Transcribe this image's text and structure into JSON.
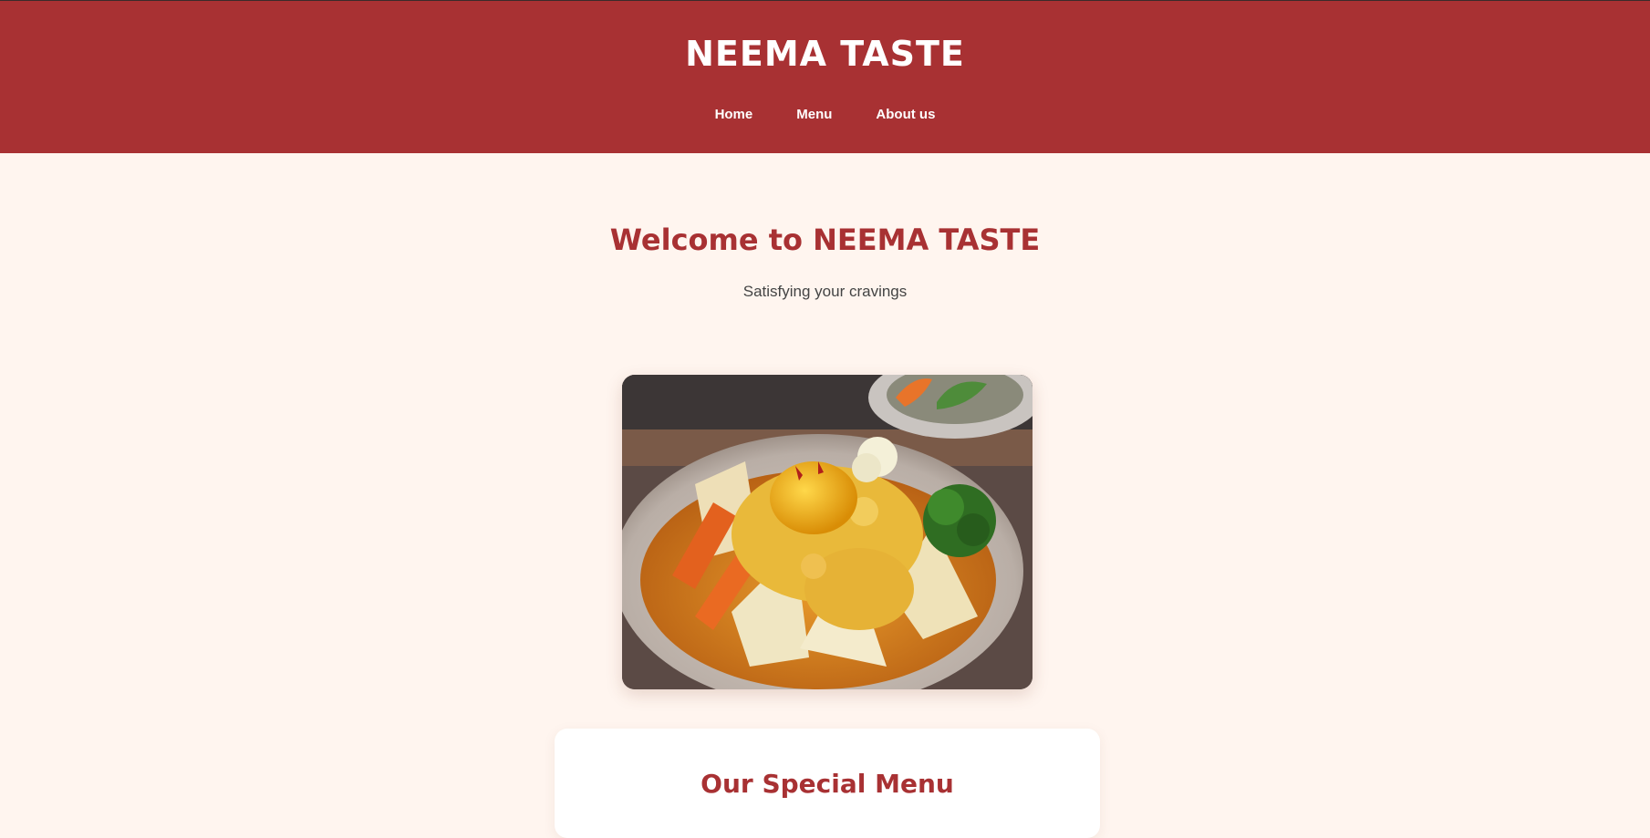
{
  "header": {
    "brand": "NEEMA TASTE",
    "nav": [
      {
        "label": "Home"
      },
      {
        "label": "Menu"
      },
      {
        "label": "About us"
      }
    ]
  },
  "hero": {
    "title": "Welcome to NEEMA TASTE",
    "subtitle": "Satisfying your cravings"
  },
  "featured_image": {
    "subject": "stewed vegetables with egg dish"
  },
  "special_menu": {
    "title": "Our Special Menu"
  },
  "colors": {
    "brand_red": "#a83133",
    "page_background": "#fff5ef",
    "card_background": "#ffffff"
  },
  "icons": {
    "nav": "none"
  }
}
